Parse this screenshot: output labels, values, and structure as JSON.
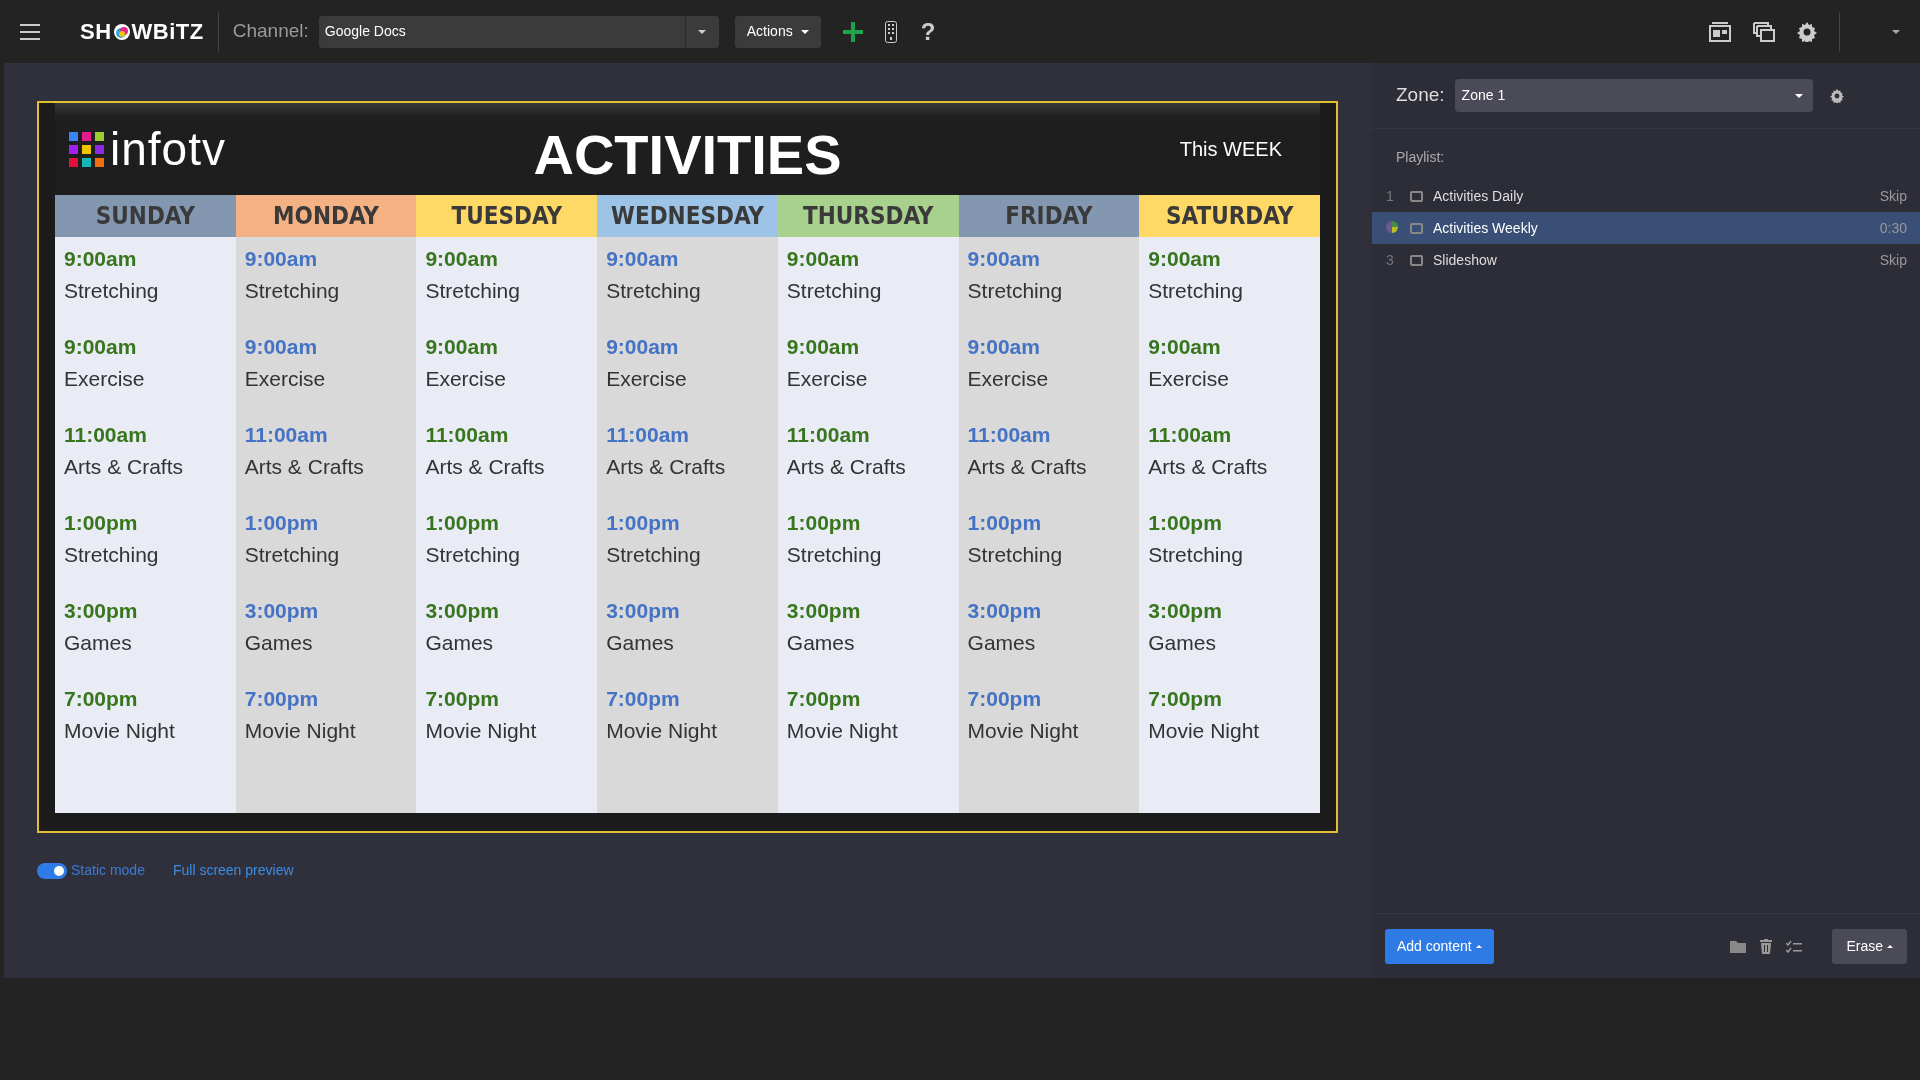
{
  "topbar": {
    "logo_left": "SH",
    "logo_right": "WBiTZ",
    "channel_label": "Channel:",
    "channel_value": "Google Docs",
    "actions_label": "Actions",
    "help": "?"
  },
  "slide": {
    "brand": "infotv",
    "title": "ACTIVITIES",
    "subtitle": "This WEEK",
    "days": [
      {
        "name": "SUNDAY",
        "color": "#8497b0",
        "kind": "light",
        "events": [
          {
            "time": "9:00am",
            "activity": "Stretching"
          },
          {
            "time": "9:00am",
            "activity": "Exercise"
          },
          {
            "time": "11:00am",
            "activity": "Arts & Crafts"
          },
          {
            "time": "1:00pm",
            "activity": "Stretching"
          },
          {
            "time": "3:00pm",
            "activity": "Games"
          },
          {
            "time": "7:00pm",
            "activity": "Movie Night"
          }
        ]
      },
      {
        "name": "MONDAY",
        "color": "#f4b183",
        "kind": "dark",
        "events": [
          {
            "time": "9:00am",
            "activity": "Stretching"
          },
          {
            "time": "9:00am",
            "activity": "Exercise"
          },
          {
            "time": "11:00am",
            "activity": "Arts & Crafts"
          },
          {
            "time": "1:00pm",
            "activity": "Stretching"
          },
          {
            "time": "3:00pm",
            "activity": "Games"
          },
          {
            "time": "7:00pm",
            "activity": "Movie Night"
          }
        ]
      },
      {
        "name": "TUESDAY",
        "color": "#ffd966",
        "kind": "light",
        "events": [
          {
            "time": "9:00am",
            "activity": "Stretching"
          },
          {
            "time": "9:00am",
            "activity": "Exercise"
          },
          {
            "time": "11:00am",
            "activity": "Arts & Crafts"
          },
          {
            "time": "1:00pm",
            "activity": "Stretching"
          },
          {
            "time": "3:00pm",
            "activity": "Games"
          },
          {
            "time": "7:00pm",
            "activity": "Movie Night"
          }
        ]
      },
      {
        "name": "WEDNESDAY",
        "color": "#9dc3e6",
        "kind": "dark",
        "events": [
          {
            "time": "9:00am",
            "activity": "Stretching"
          },
          {
            "time": "9:00am",
            "activity": "Exercise"
          },
          {
            "time": "11:00am",
            "activity": "Arts & Crafts"
          },
          {
            "time": "1:00pm",
            "activity": "Stretching"
          },
          {
            "time": "3:00pm",
            "activity": "Games"
          },
          {
            "time": "7:00pm",
            "activity": "Movie Night"
          }
        ]
      },
      {
        "name": "THURSDAY",
        "color": "#a9d18e",
        "kind": "light",
        "events": [
          {
            "time": "9:00am",
            "activity": "Stretching"
          },
          {
            "time": "9:00am",
            "activity": "Exercise"
          },
          {
            "time": "11:00am",
            "activity": "Arts & Crafts"
          },
          {
            "time": "1:00pm",
            "activity": "Stretching"
          },
          {
            "time": "3:00pm",
            "activity": "Games"
          },
          {
            "time": "7:00pm",
            "activity": "Movie Night"
          }
        ]
      },
      {
        "name": "FRIDAY",
        "color": "#8497b0",
        "kind": "dark",
        "events": [
          {
            "time": "9:00am",
            "activity": "Stretching"
          },
          {
            "time": "9:00am",
            "activity": "Exercise"
          },
          {
            "time": "11:00am",
            "activity": "Arts & Crafts"
          },
          {
            "time": "1:00pm",
            "activity": "Stretching"
          },
          {
            "time": "3:00pm",
            "activity": "Games"
          },
          {
            "time": "7:00pm",
            "activity": "Movie Night"
          }
        ]
      },
      {
        "name": "SATURDAY",
        "color": "#ffd966",
        "kind": "light",
        "events": [
          {
            "time": "9:00am",
            "activity": "Stretching"
          },
          {
            "time": "9:00am",
            "activity": "Exercise"
          },
          {
            "time": "11:00am",
            "activity": "Arts & Crafts"
          },
          {
            "time": "1:00pm",
            "activity": "Stretching"
          },
          {
            "time": "3:00pm",
            "activity": "Games"
          },
          {
            "time": "7:00pm",
            "activity": "Movie Night"
          }
        ]
      }
    ]
  },
  "preview_controls": {
    "static_mode": {
      "label": "Static mode",
      "on": true
    },
    "fullscreen_link": "Full screen preview"
  },
  "zone_panel": {
    "zone_label": "Zone:",
    "zone_value": "Zone 1",
    "playlist_label": "Playlist:",
    "items": [
      {
        "number": "1",
        "title": "Activities Daily",
        "duration": "Skip",
        "selected": false,
        "playing": false
      },
      {
        "title": "Activities Weekly",
        "duration": "0:30",
        "selected": true,
        "playing": true
      },
      {
        "number": "3",
        "title": "Slideshow",
        "duration": "Skip",
        "selected": false,
        "playing": false
      }
    ],
    "add_content": "Add content",
    "erase": "Erase"
  }
}
